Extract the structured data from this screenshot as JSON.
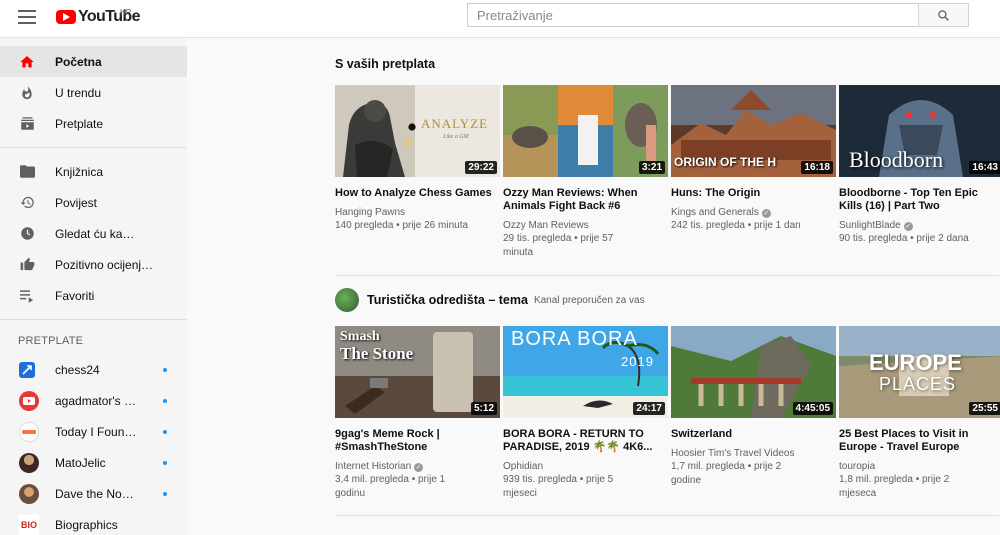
{
  "header": {
    "logo_text": "YouTube",
    "country": "HR",
    "search_placeholder": "Pretraživanje"
  },
  "sidebar": {
    "items": [
      {
        "label": "Početna",
        "icon": "home-icon"
      },
      {
        "label": "U trendu",
        "icon": "flame-icon"
      },
      {
        "label": "Pretplate",
        "icon": "subscriptions-icon"
      }
    ],
    "library": [
      {
        "label": "Knjižnica",
        "icon": "folder-icon"
      },
      {
        "label": "Povijest",
        "icon": "history-icon"
      },
      {
        "label": "Gledat ću kasnije",
        "icon": "clock-icon"
      },
      {
        "label": "Pozitivno ocijenje...",
        "icon": "thumbs-up-icon"
      },
      {
        "label": "Favoriti",
        "icon": "playlist-icon"
      }
    ],
    "subscriptions_heading": "PRETPLATE",
    "subscriptions": [
      {
        "label": "chess24",
        "color": "#1e6fd9",
        "badge": ""
      },
      {
        "label": "agadmator's C...",
        "color": "#e53935",
        "badge": ""
      },
      {
        "label": "Today I Found ...",
        "color": "#ff7043",
        "badge": ""
      },
      {
        "label": "MatoJelic",
        "color": "#5d4037",
        "badge": ""
      },
      {
        "label": "Dave the Nors...",
        "color": "#8d6e63",
        "badge": ""
      },
      {
        "label": "Biographics",
        "color": "#ffffff",
        "badge": "BIO"
      }
    ]
  },
  "section1": {
    "title": "S vaših pretplata",
    "videos": [
      {
        "title": "How to Analyze Chess Games",
        "channel": "Hanging Pawns",
        "verified": false,
        "meta": "140 pregleda • prije 26 minuta",
        "duration": "29:22"
      },
      {
        "title": "Ozzy Man Reviews: When Animals Fight Back #6",
        "channel": "Ozzy Man Reviews",
        "verified": false,
        "meta": "29 tis. pregleda • prije 57 minuta",
        "duration": "3:21"
      },
      {
        "title": "Huns: The Origin",
        "channel": "Kings and Generals",
        "verified": true,
        "meta": "242 tis. pregleda • prije 1 dan",
        "duration": "16:18"
      },
      {
        "title": "Bloodborne - Top Ten Epic Kills (16) | Part Two",
        "channel": "SunlightBlade",
        "verified": true,
        "meta": "90 tis. pregleda • prije 2 dana",
        "duration": "16:43"
      }
    ]
  },
  "section2": {
    "title": "Turistička odredišta – tema",
    "subtitle": "Kanal preporučen za vas",
    "videos": [
      {
        "title": "9gag's Meme Rock | #SmashTheStone",
        "channel": "Internet Historian",
        "verified": true,
        "meta": "3,4 mil. pregleda • prije 1 godinu",
        "duration": "5:12"
      },
      {
        "title": "BORA BORA - RETURN TO PARADISE, 2019 🌴🌴 4K6...",
        "channel": "Ophidian",
        "verified": false,
        "meta": "939 tis. pregleda • prije 5 mjeseci",
        "duration": "24:17"
      },
      {
        "title": "Switzerland",
        "channel": "Hoosier Tim's Travel Videos",
        "verified": false,
        "meta": "1,7 mil. pregleda • prije 2 godine",
        "duration": "4:45:05"
      },
      {
        "title": "25 Best Places to Visit in Europe - Travel Europe",
        "channel": "touropia",
        "verified": false,
        "meta": "1,8 mil. pregleda • prije 2 mjeseca",
        "duration": "25:55"
      }
    ]
  },
  "thumb_text": {
    "analyze": "ANALYZE",
    "analyze_sub": "Like a GM",
    "huns": "ORIGIN OF THE H",
    "bloodborne": "Bloodborn",
    "smash1": "Smash",
    "smash2": "The Stone",
    "bora": "BORA BORA",
    "bora_year": "2019",
    "europe": "EUROPE",
    "places": "PLACES"
  }
}
